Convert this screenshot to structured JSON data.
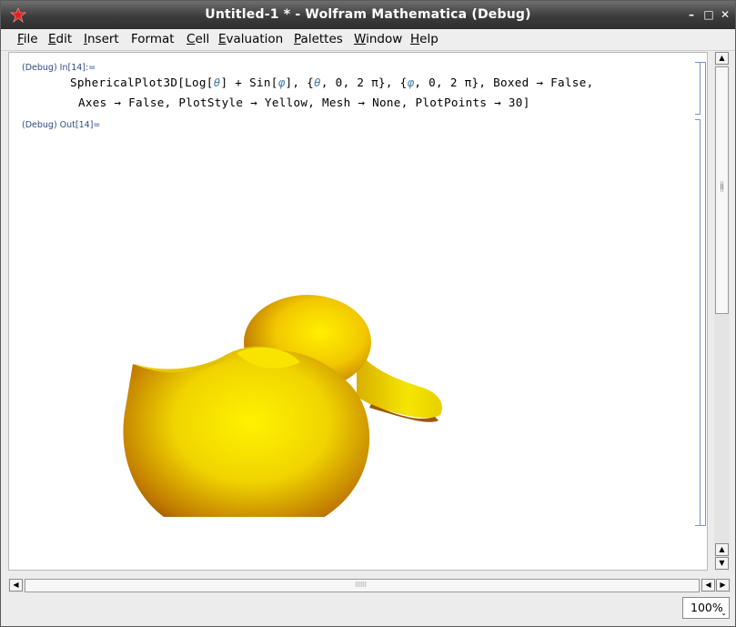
{
  "window": {
    "title": "Untitled-1 * - Wolfram Mathematica (Debug)"
  },
  "window_controls": {
    "minimize": "–",
    "maximize": "□",
    "close": "✕"
  },
  "menu": [
    {
      "label": "File",
      "u": "F",
      "rest": "ile"
    },
    {
      "label": "Edit",
      "u": "E",
      "rest": "dit"
    },
    {
      "label": "Insert",
      "u": "I",
      "rest": "nsert"
    },
    {
      "label": "Format",
      "u": "",
      "rest": "Format"
    },
    {
      "label": "Cell",
      "u": "C",
      "rest": "ell"
    },
    {
      "label": "Evaluation",
      "u": "E",
      "rest": "valuation"
    },
    {
      "label": "Palettes",
      "u": "P",
      "rest": "alettes"
    },
    {
      "label": "Window",
      "u": "W",
      "rest": "indow"
    },
    {
      "label": "Help",
      "u": "H",
      "rest": "elp"
    }
  ],
  "notebook": {
    "in_label": "(Debug) In[14]:=",
    "input_line1_a": "SphericalPlot3D[Log[",
    "input_line1_theta1": "θ",
    "input_line1_b": "] + Sin[",
    "input_line1_phi1": "φ",
    "input_line1_c": "], {",
    "input_line1_theta2": "θ",
    "input_line1_d": ", 0, 2 π}, {",
    "input_line1_phi2": "φ",
    "input_line1_e": ", 0, 2 π}, Boxed → False,",
    "input_line2": "Axes → False, PlotStyle → Yellow, Mesh → None, PlotPoints → 30]",
    "out_label": "(Debug) Out[14]="
  },
  "plot": {
    "style_color": "#f2e000",
    "shadow_color": "#8a4a00"
  },
  "status": {
    "zoom": "100%"
  },
  "scroll": {
    "up": "▲",
    "down": "▼",
    "left": "◀",
    "right": "▶"
  }
}
